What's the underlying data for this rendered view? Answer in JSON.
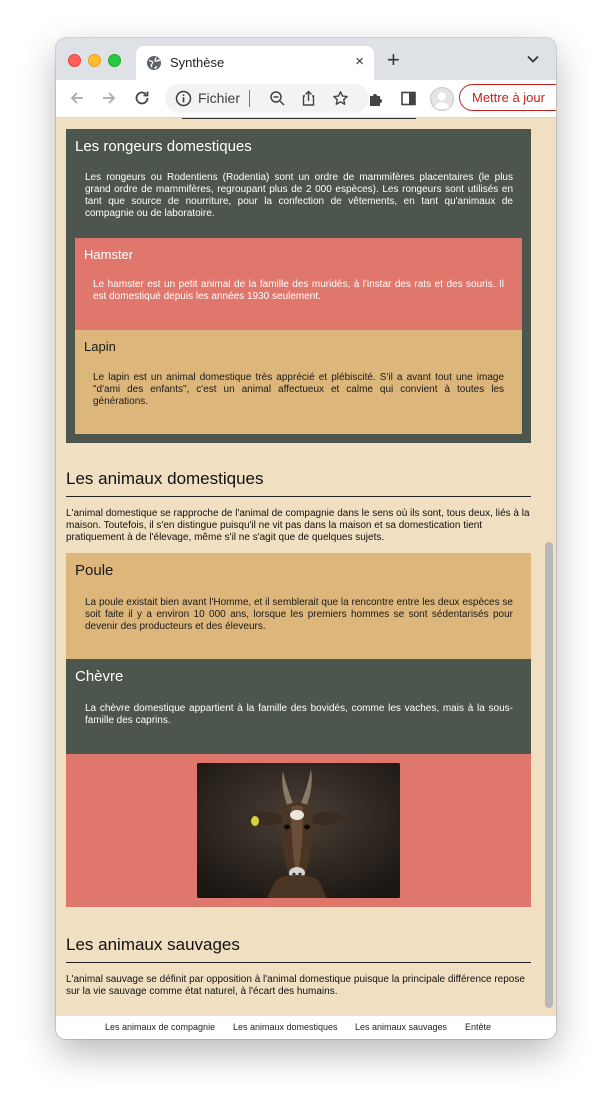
{
  "browser": {
    "tab_title": "Synthèse",
    "tab_close": "×",
    "new_tab": "+",
    "address_text": "Fichier",
    "update_button": "Mettre à jour"
  },
  "colors": {
    "page_bg": "#f1dfc2",
    "green_box": "#4d564e",
    "salmon_box": "#df776c",
    "tan_box": "#dcb67b",
    "update_accent": "#c5221f"
  },
  "icons": [
    "globe-icon",
    "chevron-down-icon",
    "back-arrow-icon",
    "forward-arrow-icon",
    "reload-icon",
    "info-icon",
    "zoom-out-icon",
    "share-icon",
    "bookmark-star-icon",
    "extensions-puzzle-icon",
    "sidebar-icon",
    "profile-avatar-icon"
  ],
  "rongeurs": {
    "title": "Les rongeurs domestiques",
    "text": "Les rongeurs ou Rodentiens (Rodentia) sont un ordre de mammifères placentaires (le plus grand ordre de mammifères, regroupant plus de 2 000 espèces). Les rongeurs sont utilisés en tant que source de nourriture, pour la confection de vêtements, en tant qu'animaux de compagnie ou de laboratoire.",
    "hamster": {
      "title": "Hamster",
      "text": "Le hamster est un petit animal de la famille des muridés, à l'instar des rats et des souris. Il est domestiqué depuis les années 1930 seulement."
    },
    "lapin": {
      "title": "Lapin",
      "text": "Le lapin est un animal domestique très apprécié et plébiscité. S'il a avant tout une image \"d'ami des enfants\", c'est un animal affectueux et calme qui convient à toutes les générations."
    }
  },
  "domestiques": {
    "title": "Les animaux domestiques",
    "text": "L'animal domestique se rapproche de l'animal de compagnie dans le sens où ils sont, tous deux, liés à la maison. Toutefois, il s'en distingue puisqu'il ne vit pas dans la maison et sa domestication tient pratiquement à de l'élevage, même s'il ne s'agit que de quelques sujets.",
    "poule": {
      "title": "Poule",
      "text": "La poule existait bien avant l'Homme, et il semblerait que la rencontre entre les deux espèces se soit faite il y a environ 10 000 ans, lorsque les premiers hommes se sont sédentarisés pour devenir des producteurs et des éleveurs."
    },
    "chevre": {
      "title": "Chèvre",
      "text": "La chèvre domestique appartient à la famille des bovidés, comme les vaches, mais à la sous-famille des caprins."
    }
  },
  "sauvages": {
    "title": "Les animaux sauvages",
    "text": "L'animal sauvage se définit par opposition à l'animal domestique puisque la principale différence repose sur la vie sauvage comme état naturel, à l'écart des humains."
  },
  "footer": {
    "links": [
      "Les animaux de compagnie",
      "Les animaux domestiques",
      "Les animaux sauvages",
      "Entête"
    ]
  }
}
